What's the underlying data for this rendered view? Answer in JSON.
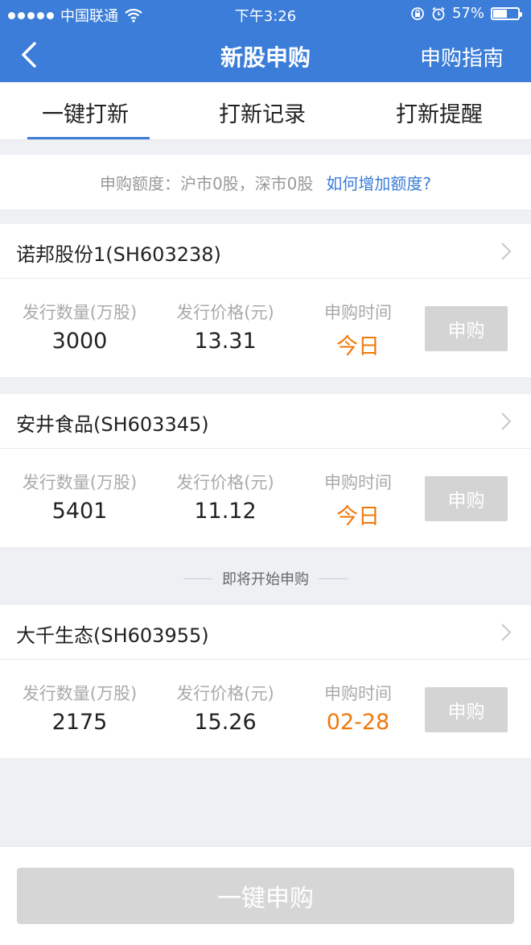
{
  "status_bar": {
    "carrier": "中国联通",
    "time": "下午3:26",
    "battery": "57%",
    "battery_level": 0.57
  },
  "nav": {
    "title": "新股申购",
    "right_link": "申购指南"
  },
  "tabs": [
    {
      "label": "一键打新"
    },
    {
      "label": "打新记录"
    },
    {
      "label": "打新提醒"
    }
  ],
  "quota": {
    "text": "申购额度：沪市0股，深市0股",
    "link": "如何增加额度?"
  },
  "columns": {
    "qty": "发行数量(万股)",
    "price": "发行价格(元)",
    "time": "申购时间"
  },
  "stocks": [
    {
      "name": "诺邦股份1(SH603238)",
      "qty": "3000",
      "price": "13.31",
      "time": "今日",
      "button": "申购"
    },
    {
      "name": "安井食品(SH603345)",
      "qty": "5401",
      "price": "11.12",
      "time": "今日",
      "button": "申购"
    },
    {
      "name": "大千生态(SH603955)",
      "qty": "2175",
      "price": "15.26",
      "time": "02-28",
      "button": "申购"
    }
  ],
  "upcoming_label": "即将开始申购",
  "bottom_button": "一键申购",
  "colors": {
    "primary": "#3b7dd8",
    "accent": "#f0780a",
    "disabled": "#d4d4d4"
  }
}
